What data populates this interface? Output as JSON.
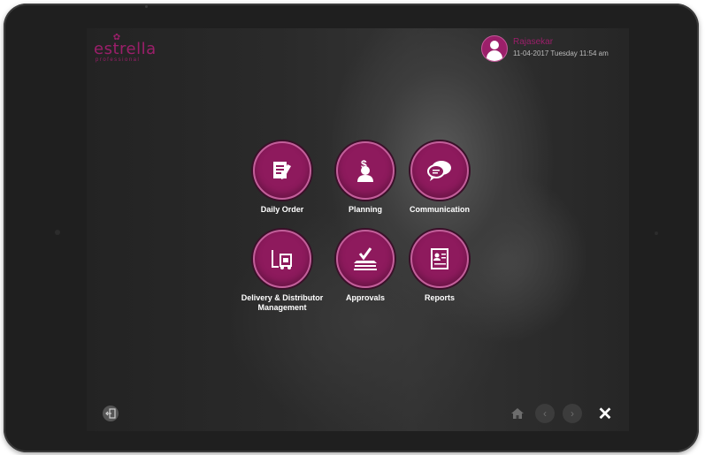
{
  "brand": {
    "name": "estrella",
    "tagline": "professional",
    "color": "#9b1f6a"
  },
  "user": {
    "name": "Rajasekar",
    "datetime": "11-04-2017  Tuesday  11:54 am",
    "avatar_icon": "user-icon"
  },
  "menu": {
    "items": [
      {
        "label": "Daily Order",
        "icon": "order-form-icon"
      },
      {
        "label": "Planning",
        "icon": "money-user-icon"
      },
      {
        "label": "Communication",
        "icon": "chat-bubbles-icon"
      },
      {
        "label": "Delivery & Distributor Management",
        "icon": "forklift-icon"
      },
      {
        "label": "Approvals",
        "icon": "checkmark-stack-icon"
      },
      {
        "label": "Reports",
        "icon": "report-document-icon"
      }
    ]
  },
  "footer": {
    "logout_icon": "logout-icon",
    "home_icon": "home-icon",
    "back_icon": "chevron-left-icon",
    "forward_icon": "chevron-right-icon",
    "close_glyph": "✕"
  },
  "colors": {
    "accent": "#8e1a5d",
    "accent_border": "#c25f9a"
  }
}
